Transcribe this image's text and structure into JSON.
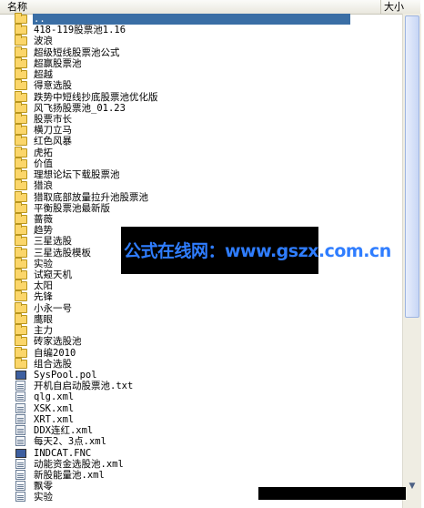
{
  "header": {
    "name_label": "名称",
    "size_label": "大小"
  },
  "files": [
    {
      "name": "..",
      "type": "folder",
      "selected": true
    },
    {
      "name": "418-119股票池1.16",
      "type": "folder"
    },
    {
      "name": "波浪",
      "type": "folder"
    },
    {
      "name": "超级短线股票池公式",
      "type": "folder"
    },
    {
      "name": "超赢股票池",
      "type": "folder"
    },
    {
      "name": "超越",
      "type": "folder"
    },
    {
      "name": "得意选股",
      "type": "folder"
    },
    {
      "name": "跌势中短线抄底股票池优化版",
      "type": "folder"
    },
    {
      "name": "风飞扬股票池_01.23",
      "type": "folder"
    },
    {
      "name": "股票市长",
      "type": "folder"
    },
    {
      "name": "横刀立马",
      "type": "folder"
    },
    {
      "name": "红色风暴",
      "type": "folder"
    },
    {
      "name": "虎拓",
      "type": "folder"
    },
    {
      "name": "价值",
      "type": "folder"
    },
    {
      "name": "理想论坛下载股票池",
      "type": "folder"
    },
    {
      "name": "猎浪",
      "type": "folder"
    },
    {
      "name": "猎取底部放量拉升池股票池",
      "type": "folder"
    },
    {
      "name": "平衡股票池最新版",
      "type": "folder"
    },
    {
      "name": "蔷薇",
      "type": "folder"
    },
    {
      "name": "趋势",
      "type": "folder"
    },
    {
      "name": "三星选股",
      "type": "folder"
    },
    {
      "name": "三星选股模板",
      "type": "folder"
    },
    {
      "name": "实验",
      "type": "folder"
    },
    {
      "name": "试窥天机",
      "type": "folder"
    },
    {
      "name": "太阳",
      "type": "folder"
    },
    {
      "name": "先锋",
      "type": "folder"
    },
    {
      "name": "小永一号",
      "type": "folder"
    },
    {
      "name": "鹰眼",
      "type": "folder"
    },
    {
      "name": "主力",
      "type": "folder"
    },
    {
      "name": "砖家选股池",
      "type": "folder"
    },
    {
      "name": "自编2010",
      "type": "folder"
    },
    {
      "name": "组合选股",
      "type": "folder"
    },
    {
      "name": "SysPool.pol",
      "type": "file-dark"
    },
    {
      "name": "开机自启动股票池.txt",
      "type": "file"
    },
    {
      "name": "qlg.xml",
      "type": "file"
    },
    {
      "name": "XSK.xml",
      "type": "file"
    },
    {
      "name": "XRT.xml",
      "type": "file"
    },
    {
      "name": "DDX连红.xml",
      "type": "file"
    },
    {
      "name": "每天2、3点.xml",
      "type": "file"
    },
    {
      "name": "INDCAT.FNC",
      "type": "file-dark"
    },
    {
      "name": "动能资金选股池.xml",
      "type": "file"
    },
    {
      "name": "新股能量池.xml",
      "type": "file"
    },
    {
      "name": "飘零",
      "type": "file"
    },
    {
      "name": "实验",
      "type": "file"
    }
  ],
  "watermark": {
    "text": "公式在线网：www.gszx.com.cn"
  },
  "scrollbar": {
    "up_icon": "up-arrow-icon",
    "down_icon": "down-arrow-icon"
  }
}
